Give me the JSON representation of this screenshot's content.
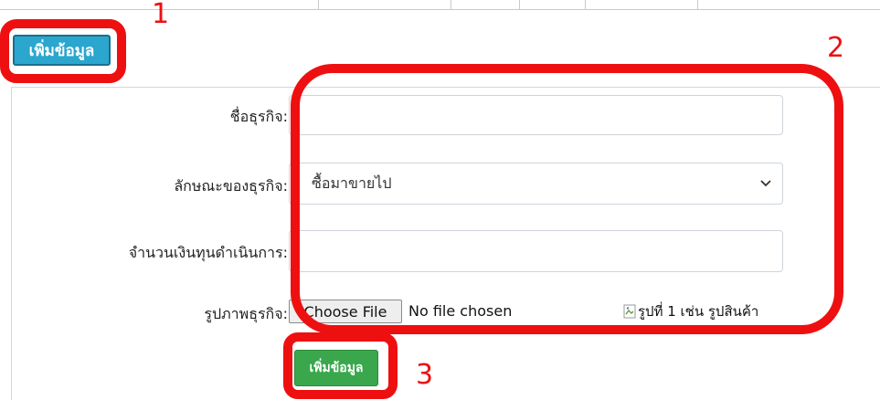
{
  "top_button": {
    "label": "เพิ่มข้อมูล"
  },
  "form": {
    "business_name": {
      "label": "ชื่อธุรกิจ:",
      "value": ""
    },
    "business_type": {
      "label": "ลักษณะของธุรกิจ:",
      "selected": "ซื้อมาขายไป"
    },
    "capital": {
      "label": "จำนวนเงินทุนดำเนินการ:",
      "value": ""
    },
    "image": {
      "label": "รูปภาพธุรกิจ:",
      "button_label": "Choose File",
      "status": "No file chosen",
      "preview_alt": "รูปที่ 1 เช่น รูปสินค้า"
    },
    "submit_label": "เพิ่มข้อมูล"
  },
  "annotations": {
    "color": "#ee1010",
    "labels": [
      "1",
      "2",
      "3"
    ]
  },
  "colors": {
    "top_button": "#2aa6cf",
    "submit_button": "#3aa74c"
  }
}
